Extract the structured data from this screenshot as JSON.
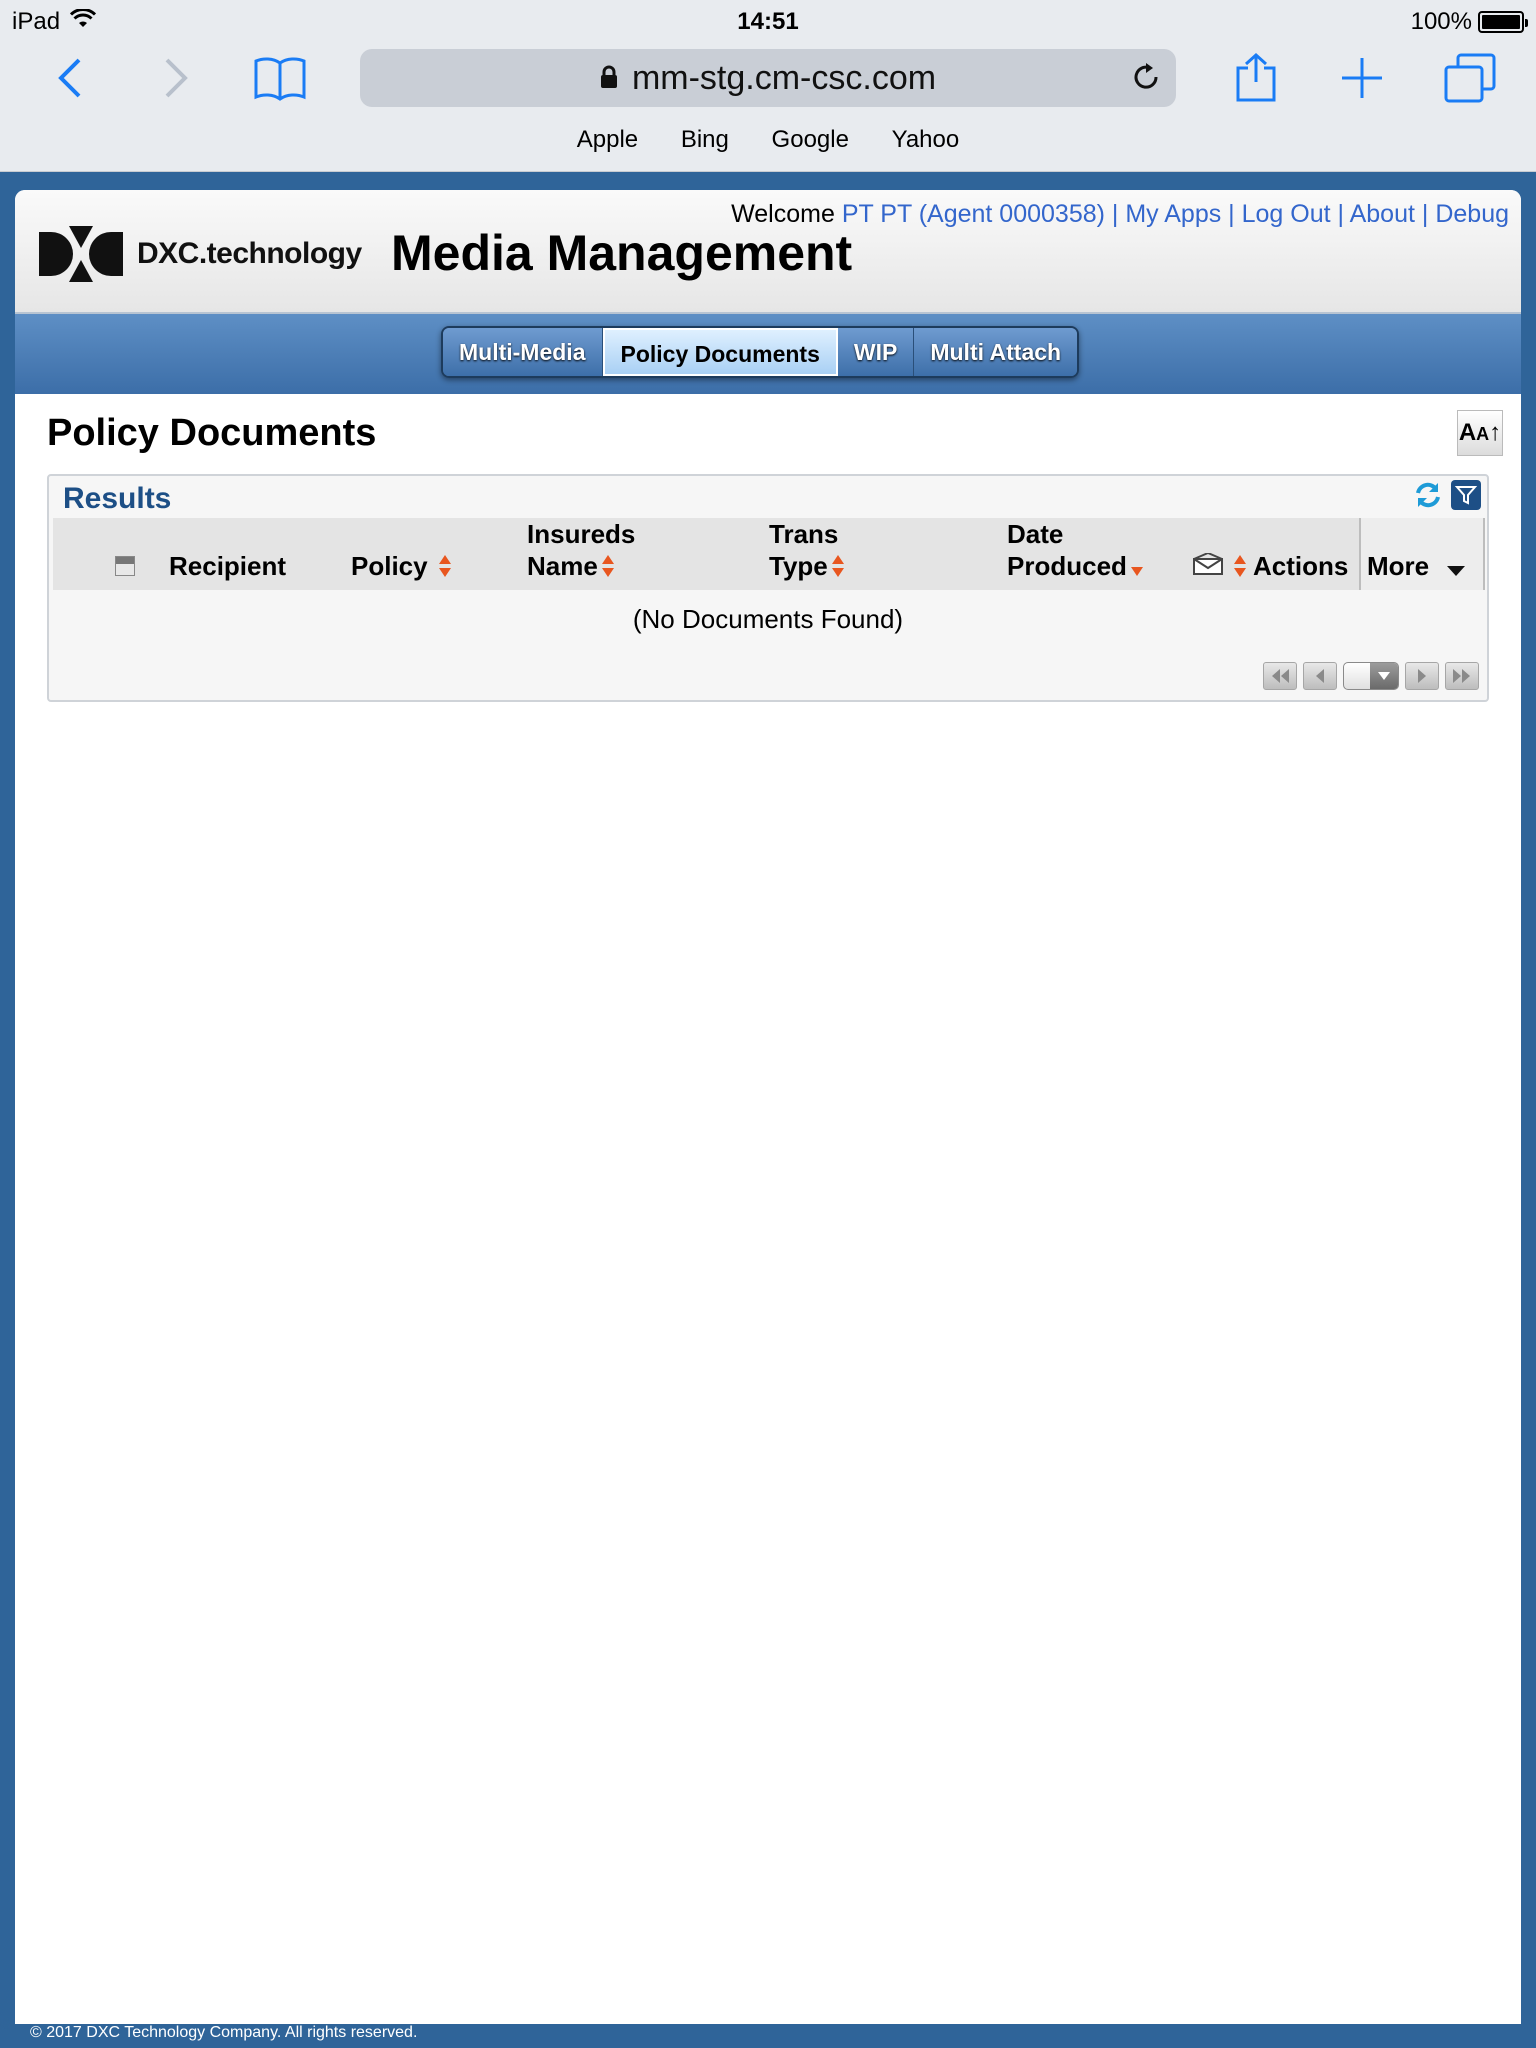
{
  "status_bar": {
    "device": "iPad",
    "time": "14:51",
    "battery": "100%"
  },
  "browser": {
    "url": "mm-stg.cm-csc.com",
    "bookmarks": [
      "Apple",
      "Bing",
      "Google",
      "Yahoo"
    ]
  },
  "header": {
    "logo_text": "DXC.technology",
    "app_title": "Media Management",
    "welcome_label": "Welcome",
    "user_link": "PT PT (Agent 0000358)",
    "links": [
      "My Apps",
      "Log Out",
      "About",
      "Debug"
    ],
    "separator": " | "
  },
  "tabs": [
    {
      "label": "Multi-Media",
      "active": false
    },
    {
      "label": "Policy Documents",
      "active": true
    },
    {
      "label": "WIP",
      "active": false
    },
    {
      "label": "Multi Attach",
      "active": false
    }
  ],
  "page_title": "Policy Documents",
  "font_size_button": "AA",
  "results": {
    "title": "Results",
    "columns": {
      "recipient": "Recipient",
      "policy": "Policy",
      "insureds_name_line1": "Insureds",
      "insureds_name_line2": "Name",
      "trans_type_line1": "Trans",
      "trans_type_line2": "Type",
      "date_produced_line1": "Date",
      "date_produced_line2": "Produced",
      "actions": "Actions",
      "more": "More"
    },
    "empty_message": "(No Documents Found)"
  },
  "footer": "© 2017 DXC Technology Company. All rights reserved.",
  "colors": {
    "link": "#3366cc",
    "results_title": "#1d4f86",
    "tab_band": "#3c6ea8",
    "sort_arrow": "#e8561f",
    "page_bg": "#2f6499"
  }
}
